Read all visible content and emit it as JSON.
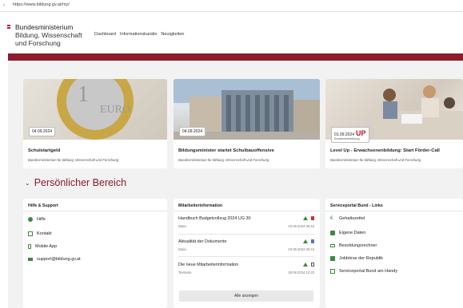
{
  "browser": {
    "url": "https://www.bildung.gv.at/my/"
  },
  "header": {
    "logo_line1": "Bundesministerium",
    "logo_line2": "Bildung, Wissenschaft",
    "logo_line3": "und Forschung",
    "nav": [
      "Dashboard",
      "Informationskanäle",
      "Neuigkeiten"
    ]
  },
  "news": [
    {
      "date": "04.09.2024",
      "title": "Schulstartgeld",
      "subtitle": "Bundesministerium für Bildung, Wissenschaft und Forschung",
      "image": "euro-coin"
    },
    {
      "date": "04.09.2024",
      "title": "Bildungsminister startet Schulbauoffensive",
      "subtitle": "Bundesministerium für Bildung, Wissenschaft und Forschung",
      "image": "school-building"
    },
    {
      "date": "01.09.2024",
      "badge": "UP",
      "badge_sub": "Erwachsenenbildung",
      "title": "Level Up - Erwachsenenbildung: Start Förder-Call",
      "subtitle": "Bundesministerium für Bildung, Wissenschaft und Forschung",
      "image": "people-at-table"
    }
  ],
  "section": {
    "title": "Persönlicher Bereich"
  },
  "help": {
    "title": "Hilfe & Support",
    "items": [
      {
        "label": "Hilfe",
        "icon": "help-circle-icon"
      },
      {
        "label": "Kontakt",
        "icon": "contact-icon"
      },
      {
        "label": "Mobile App",
        "icon": "mobile-icon"
      },
      {
        "label": "support@bildung.gv.at",
        "icon": "mail-icon"
      }
    ]
  },
  "staff": {
    "title": "Mitarbeiterinformation",
    "items": [
      {
        "title": "Handbuch Budgetvollzug 2024 UG 30",
        "meta_label": "Datei",
        "meta_value": "03.09.2024 09:18"
      },
      {
        "title": "Aktualität der Dokumente",
        "meta_label": "Datei",
        "meta_value": "03.09.2024 09:15"
      },
      {
        "title": "Die neue Mitarbeiterinformation",
        "meta_label": "Textseite",
        "meta_value": "28.08.2024 12:23"
      }
    ],
    "all_button": "Alle anzeigen"
  },
  "service": {
    "title": "Serviceportal Bund - Links",
    "items": [
      {
        "label": "Gehaltszettel",
        "icon": "euro-icon"
      },
      {
        "label": "Eigene Daten",
        "icon": "user-data-icon"
      },
      {
        "label": "Besoldungsrechner",
        "icon": "calculator-icon"
      },
      {
        "label": "Jobbörse der Republik",
        "icon": "job-icon"
      },
      {
        "label": "Serviceportal Bund am Handy",
        "icon": "phone-icon"
      }
    ]
  },
  "colors": {
    "brand_red": "#8d1b2c",
    "icon_green": "#3b8a3e",
    "background": "#f2f2f2"
  }
}
